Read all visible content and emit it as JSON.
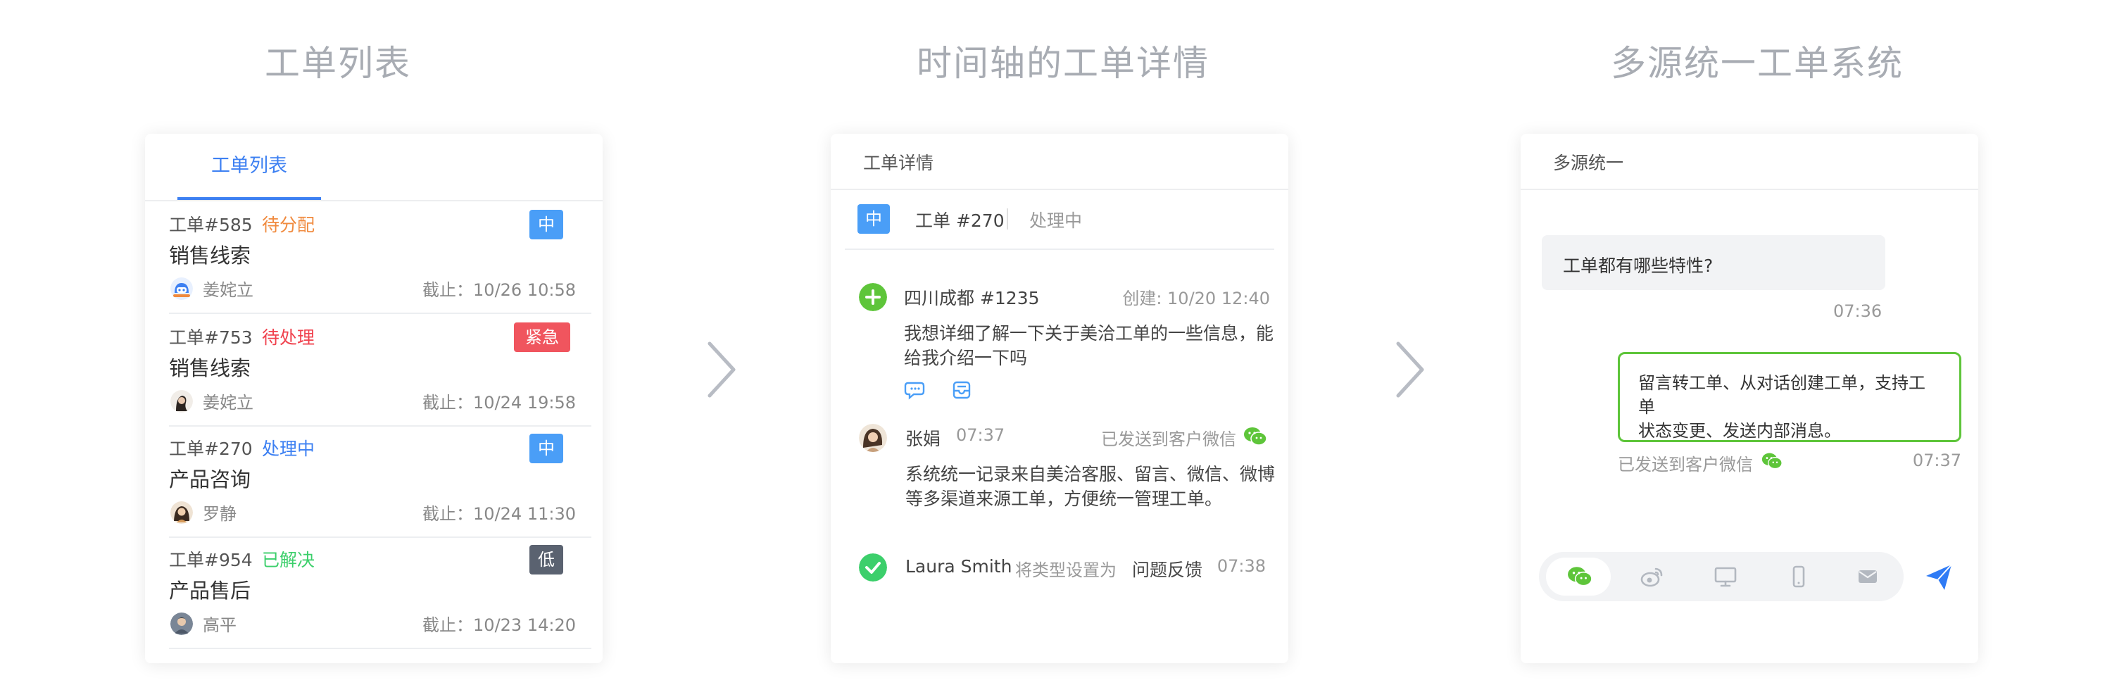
{
  "sections": [
    {
      "title": "工单列表"
    },
    {
      "title": "时间轴的工单详情"
    },
    {
      "title": "多源统一工单系统"
    }
  ],
  "card1": {
    "tab": "工单列表",
    "tickets": [
      {
        "id": "工单#585",
        "status": "待分配",
        "status_color": "#f08a3e",
        "title": "销售线索",
        "assignee": "姜姹立",
        "deadline": "截止：10/26 10:58",
        "badge": "中",
        "badge_color": "#4a9ef7",
        "avatar": "robot-avatar"
      },
      {
        "id": "工单#753",
        "status": "待处理",
        "status_color": "#f0414d",
        "title": "销售线索",
        "assignee": "姜姹立",
        "deadline": "截止：10/24 19:58",
        "badge": "紧急",
        "badge_color": "#f0555e",
        "avatar": "person-avatar"
      },
      {
        "id": "工单#270",
        "status": "处理中",
        "status_color": "#3d80f2",
        "title": "产品咨询",
        "assignee": "罗静",
        "deadline": "截止：10/24 11:30",
        "badge": "中",
        "badge_color": "#4a9ef7",
        "avatar": "person-avatar"
      },
      {
        "id": "工单#954",
        "status": "已解决",
        "status_color": "#3ccf6b",
        "title": "产品售后",
        "assignee": "高平",
        "deadline": "截止：10/23 14:20",
        "badge": "低",
        "badge_color": "#5a6270",
        "avatar": "person-avatar"
      }
    ]
  },
  "card2": {
    "header": "工单详情",
    "priority": "中",
    "ticket": "工单 #270",
    "status": "处理中",
    "events": [
      {
        "source": "四川成都 #1235",
        "created": "创建: 10/20 12:40",
        "text": [
          "我想详细了解一下关于美洽工单的一些信息，能",
          "给我介绍一下吗"
        ]
      },
      {
        "name": "张娟",
        "time": "07:37",
        "sent": "已发送到客户微信",
        "text": [
          "系统统一记录来自美洽客服、留言、微信、微博",
          "等多渠道来源工单，方便统一管理工单。"
        ]
      },
      {
        "name": "Laura Smith",
        "action": "将类型设置为",
        "value": "问题反馈",
        "time": "07:38"
      }
    ]
  },
  "card3": {
    "header": "多源统一",
    "question": "工单都有哪些特性?",
    "question_time": "07:36",
    "answer": [
      "留言转工单、从对话创建工单，支持工单",
      "状态变更、发送内部消息。"
    ],
    "answer_status": "已发送到客户微信",
    "answer_time": "07:37",
    "channels": [
      "wechat-icon",
      "weibo-icon",
      "web-icon",
      "mobile-icon",
      "email-icon"
    ],
    "colors": {
      "wechat": "#5ec53a",
      "send": "#2f7bf5"
    }
  }
}
